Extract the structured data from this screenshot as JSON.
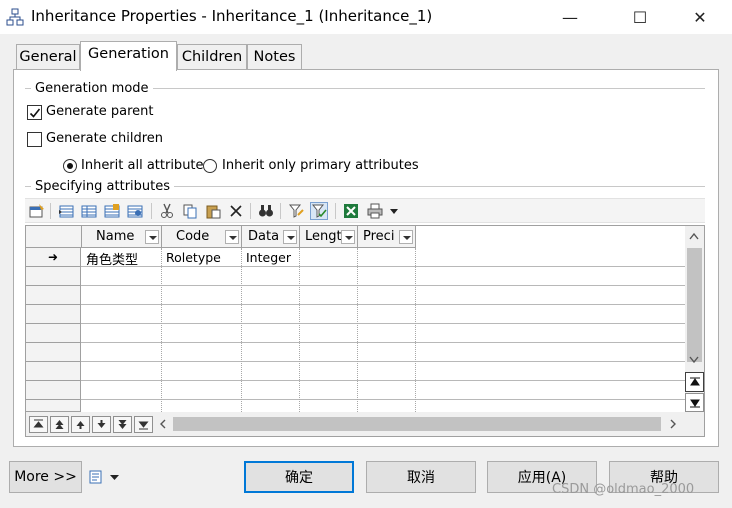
{
  "window": {
    "title": "Inheritance Properties - Inheritance_1 (Inheritance_1)",
    "minimize_glyph": "—",
    "maximize_glyph": "☐",
    "close_glyph": "✕",
    "icon": "hierarchy-icon"
  },
  "tabs": [
    {
      "label": "General"
    },
    {
      "label": "Generation",
      "active": true
    },
    {
      "label": "Children"
    },
    {
      "label": "Notes"
    }
  ],
  "generation_mode": {
    "group_label": "Generation mode",
    "generate_parent": {
      "label": "Generate parent",
      "checked": true
    },
    "generate_children": {
      "label": "Generate children",
      "checked": false
    },
    "inherit_all": {
      "label": "Inherit all attributes",
      "selected": true
    },
    "inherit_primary": {
      "label": "Inherit only primary attributes",
      "selected": false
    }
  },
  "specifying": {
    "group_label": "Specifying attributes",
    "toolbar_icons": [
      "properties-icon",
      "add-row-icon",
      "insert-row-icon",
      "add-attributes-icon",
      "reuse-attributes-icon",
      "cut-icon",
      "copy-icon",
      "paste-icon",
      "delete-icon",
      "find-icon",
      "filter-icon",
      "customize-columns-icon",
      "excel-export-icon",
      "print-icon",
      "dropdown-arrow-icon"
    ],
    "columns": [
      "Name",
      "Code",
      "Data",
      "Lengt",
      "Preci"
    ],
    "rows": [
      {
        "name": "角色类型",
        "code": "Roletype",
        "data": "Integer",
        "length": "",
        "precision": ""
      }
    ],
    "current_row_marker": "➜"
  },
  "buttons": {
    "more": "More >>",
    "ok": "确定",
    "cancel": "取消",
    "apply": "应用(A)",
    "help": "帮助"
  },
  "watermark": "CSDN @oldmao_2000",
  "colors": {
    "accent": "#0078d7",
    "tab_page": "#ffffff",
    "dialog_bg": "#f0f0f0"
  }
}
